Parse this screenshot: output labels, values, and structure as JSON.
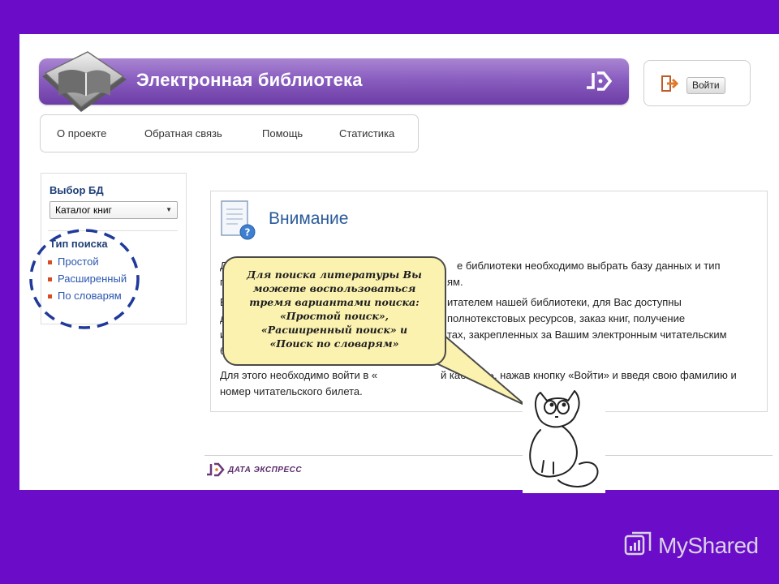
{
  "header": {
    "title": "Электронная библиотека",
    "login_label": "Войти"
  },
  "nav": [
    "О проекте",
    "Обратная связь",
    "Помощь",
    "Статистика"
  ],
  "sidebar": {
    "db_title": "Выбор БД",
    "db_selected": "Каталог книг",
    "search_type_title": "Тип поиска",
    "search_types": [
      "Простой",
      "Расширенный",
      "По словарям"
    ]
  },
  "main": {
    "title": "Внимание",
    "lines": [
      "Д",
      "п",
      "Е",
      "д",
      "и",
      "б",
      "е библиотеки необходимо выбрать базу данных и тип",
      "ям.",
      "итателем нашей библиотеки, для Вас доступны",
      "полнотекстовых ресурсов, заказ книг, получение",
      "тах, закрепленных за Вашим электронным читательским",
      "Для этого необходимо войти в «",
      "й кабинет», нажав кнопку «Войти» и введя свою фамилию и",
      "номер читательского билета."
    ]
  },
  "callout": {
    "lines": [
      "Для поиска литературы Вы",
      "можете воспользоваться",
      "тремя вариантами поиска:",
      "«Простой поиск»,",
      "«Расширенный поиск» и",
      "«Поиск по словарям»"
    ]
  },
  "footer": {
    "logo_text": "ДАТА ЭКСПРЕСС"
  },
  "watermark": {
    "text": "MyShared"
  }
}
